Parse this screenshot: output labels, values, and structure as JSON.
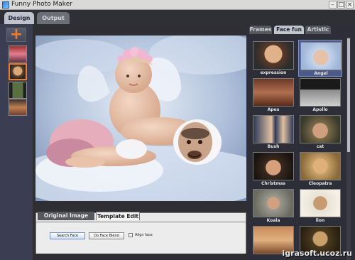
{
  "window": {
    "title": "Funny Photo Maker",
    "controls": [
      "–",
      "□",
      "×"
    ]
  },
  "main_tabs": [
    {
      "label": "Design",
      "active": true
    },
    {
      "label": "Output",
      "active": false
    }
  ],
  "left_rail": {
    "add_icon": "plus-icon",
    "thumbnails": [
      "thumb-1",
      "thumb-2",
      "thumb-3",
      "thumb-4"
    ]
  },
  "edit_panel": {
    "tabs": [
      {
        "label": "Original Image Edit",
        "active": false
      },
      {
        "label": "Template Edit",
        "active": true
      }
    ],
    "search_face_label": "Search Face",
    "face_blend_label": "Do Face Blend",
    "align_face_label": "Align face"
  },
  "right_panel": {
    "tabs": [
      {
        "label": "Frames",
        "active": false
      },
      {
        "label": "Face fun",
        "active": true
      },
      {
        "label": "Artistic",
        "active": false
      }
    ],
    "templates": [
      {
        "label": "expression",
        "color": "#7a5a45"
      },
      {
        "label": "Angel",
        "color": "#9fb7d9"
      },
      {
        "label": "Apes",
        "color": "#7a3b2b"
      },
      {
        "label": "Apollo",
        "color": "#707070"
      },
      {
        "label": "Bush",
        "color": "#3c4e6b"
      },
      {
        "label": "cat",
        "color": "#8a7a5a"
      },
      {
        "label": "Christmas",
        "color": "#3a2a20"
      },
      {
        "label": "Cleopatra",
        "color": "#c9a36a"
      },
      {
        "label": "Koala",
        "color": "#8a8a80"
      },
      {
        "label": "lion",
        "color": "#d6d0c0"
      },
      {
        "label": "",
        "color": "#c88a5a"
      },
      {
        "label": "",
        "color": "#6a5030"
      }
    ]
  },
  "watermark": "igrasoft.ucoz.ru"
}
